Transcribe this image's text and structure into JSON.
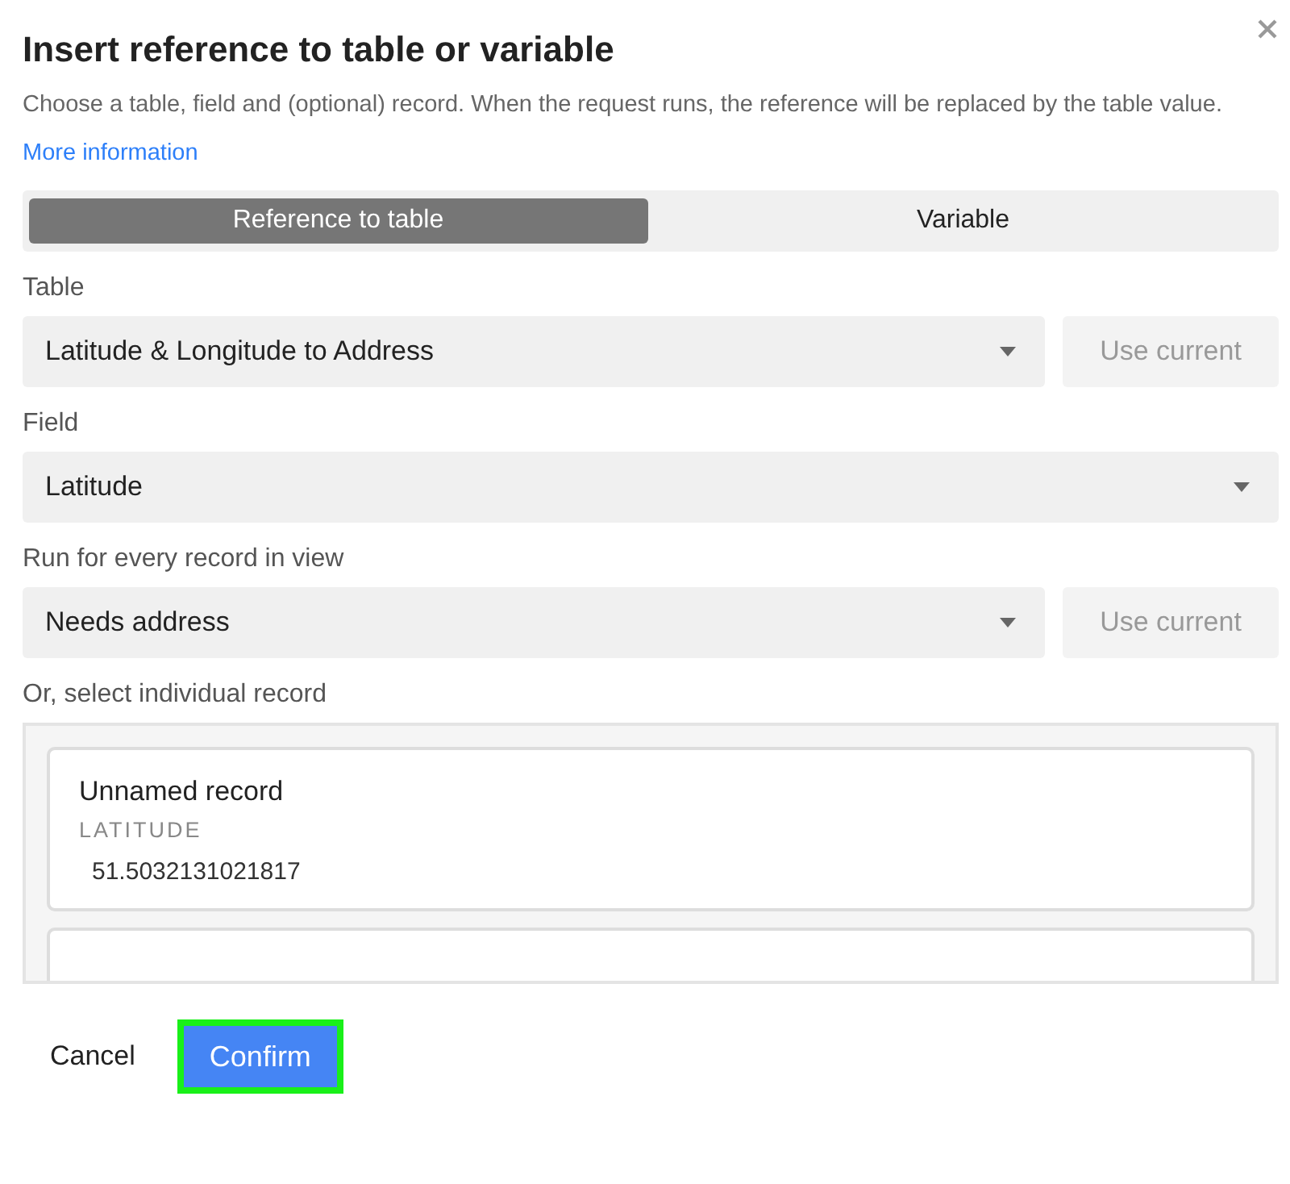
{
  "dialog": {
    "title": "Insert reference to table or variable",
    "description": "Choose a table, field and (optional) record. When the request runs, the reference will be replaced by the table value.",
    "link": "More information"
  },
  "tabs": [
    {
      "label": "Reference to table",
      "selected": true
    },
    {
      "label": "Variable",
      "selected": false
    }
  ],
  "fields": [
    {
      "label": "Table",
      "value": "Latitude & Longitude to Address",
      "button": "Use current"
    },
    {
      "label": "Field",
      "value": "Latitude"
    },
    {
      "label": "Run for every record in view",
      "value": "Needs address",
      "button": "Use current"
    }
  ],
  "records": {
    "label": "Or, select individual record",
    "items": [
      {
        "name": "Unnamed record",
        "field": "LATITUDE",
        "value": "51.5032131021817"
      }
    ]
  },
  "footer": {
    "cancel": "Cancel",
    "confirm": "Confirm",
    "confirm_highlighted": true
  }
}
